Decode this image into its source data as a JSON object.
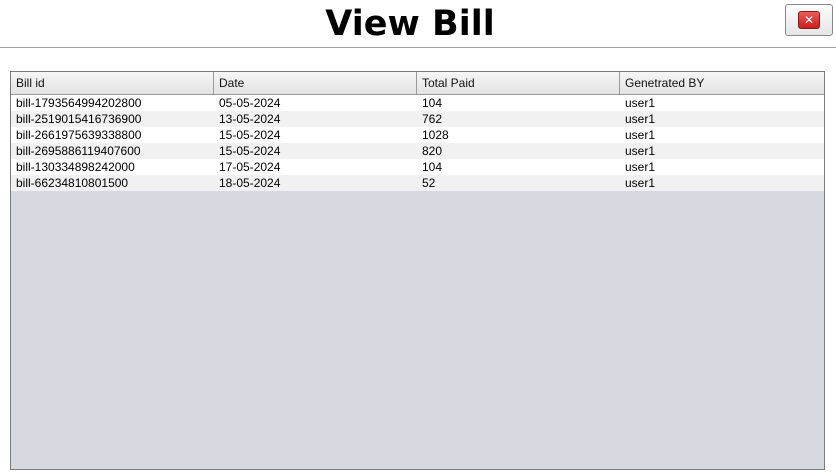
{
  "title": "View Bill",
  "close_button": {
    "icon": "close-icon",
    "glyph": "✕"
  },
  "colors": {
    "close_red": "#d42a2a",
    "table_empty_bg": "#d6d9df",
    "row_alt": "#f1f1f1"
  },
  "table": {
    "columns": [
      "Bill id",
      "Date",
      "Total Paid",
      "Genetrated BY"
    ],
    "rows": [
      [
        "bill-1793564994202800",
        "05-05-2024",
        "104",
        "user1"
      ],
      [
        "bill-2519015416736900",
        "13-05-2024",
        "762",
        "user1"
      ],
      [
        "bill-2661975639338800",
        "15-05-2024",
        "1028",
        "user1"
      ],
      [
        "bill-2695886119407600",
        "15-05-2024",
        "820",
        "user1"
      ],
      [
        "bill-130334898242000",
        "17-05-2024",
        "104",
        "user1"
      ],
      [
        "bill-66234810801500",
        "18-05-2024",
        "52",
        "user1"
      ]
    ]
  }
}
